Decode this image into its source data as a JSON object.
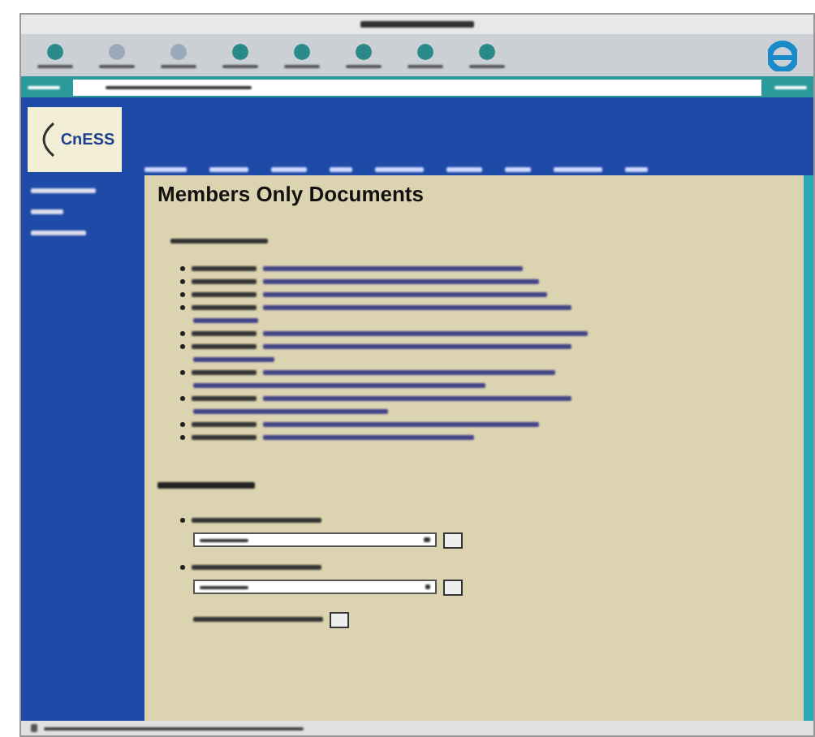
{
  "site": {
    "logo": "CnESS"
  },
  "content": {
    "heading": "Members Only Documents"
  }
}
